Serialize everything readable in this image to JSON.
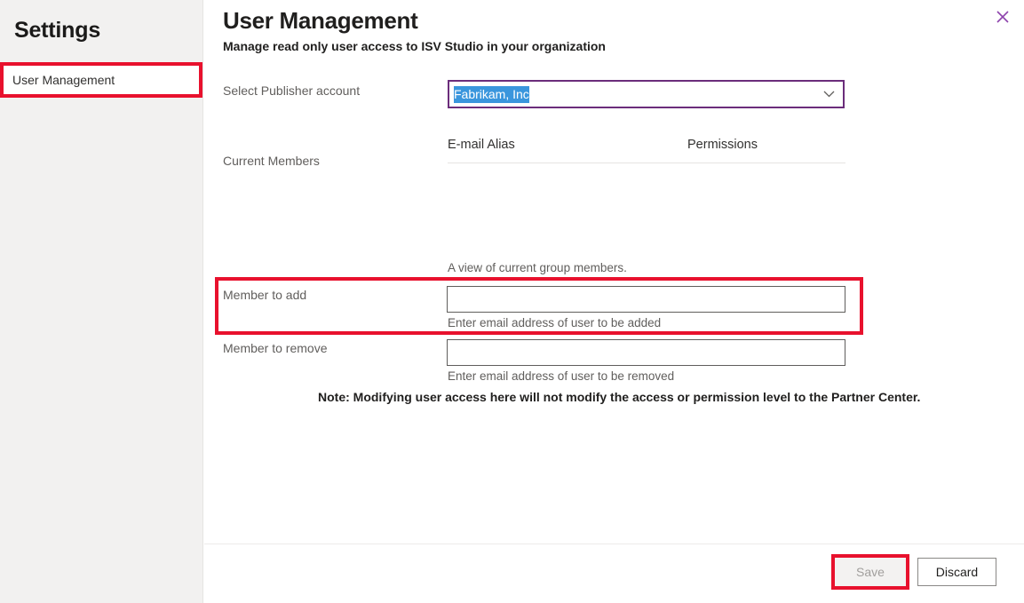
{
  "sidebar": {
    "title": "Settings",
    "items": [
      {
        "label": "User Management",
        "selected": true,
        "highlighted": true
      }
    ]
  },
  "header": {
    "title": "User Management",
    "subtitle": "Manage read only user access to ISV Studio in your organization",
    "close_icon": "close-icon"
  },
  "form": {
    "publisher": {
      "label": "Select Publisher account",
      "value": "Fabrikam, Inc",
      "selected_text": true,
      "chevron_icon": "chevron-down-icon",
      "border_color": "#6b2d7b",
      "selection_color": "#3a96dd"
    },
    "current_members": {
      "label": "Current Members",
      "columns": [
        "E-mail Alias",
        "Permissions"
      ],
      "rows": [],
      "caption": "A view of current group members."
    },
    "member_to_add": {
      "label": "Member to add",
      "value": "",
      "placeholder": "",
      "help": "Enter email address of user to be added",
      "highlighted": true
    },
    "member_to_remove": {
      "label": "Member to remove",
      "value": "",
      "placeholder": "",
      "help": "Enter email address of user to be removed",
      "highlighted": false
    },
    "note": "Note: Modifying user access here will not modify the access or permission level to the Partner Center."
  },
  "footer": {
    "save_label": "Save",
    "save_disabled": true,
    "save_highlighted": true,
    "discard_label": "Discard"
  },
  "colors": {
    "highlight_red": "#e8112d",
    "accent_purple": "#6b2d7b",
    "selection_blue": "#3a96dd",
    "sidebar_bg": "#f2f1f0"
  }
}
